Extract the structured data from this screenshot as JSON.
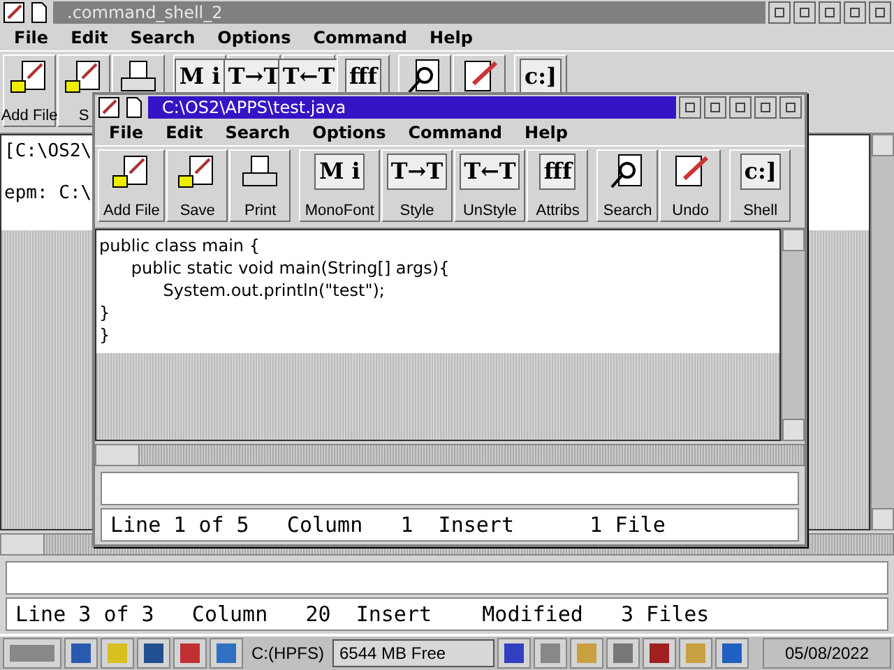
{
  "outer_window": {
    "title": ".command_shell_2",
    "active": false,
    "menu": [
      "File",
      "Edit",
      "Search",
      "Options",
      "Command",
      "Help"
    ],
    "toolbar": [
      [
        {
          "kind": "addfile",
          "label": "Add File"
        },
        {
          "kind": "save",
          "label": "S"
        },
        {
          "kind": "print"
        }
      ],
      [
        {
          "kind": "glyph",
          "glyph": "M i"
        },
        {
          "kind": "glyph",
          "glyph": "T→T"
        },
        {
          "kind": "glyph",
          "glyph": "T←T"
        },
        {
          "kind": "glyph",
          "glyph": "fff"
        }
      ],
      [
        {
          "kind": "search"
        },
        {
          "kind": "undo"
        }
      ],
      [
        {
          "kind": "glyph",
          "glyph": "c:]"
        }
      ]
    ],
    "lines": [
      "[C:\\OS2\\",
      "epm: C:\\"
    ],
    "status": "Line 3 of 3   Column   20  Insert    Modified   3 Files"
  },
  "inner_window": {
    "title": "C:\\OS2\\APPS\\test.java",
    "active": true,
    "menu": [
      "File",
      "Edit",
      "Search",
      "Options",
      "Command",
      "Help"
    ],
    "toolbar": [
      [
        {
          "kind": "addfile",
          "label": "Add File"
        },
        {
          "kind": "save",
          "label": "Save"
        },
        {
          "kind": "print",
          "label": "Print"
        }
      ],
      [
        {
          "kind": "glyph",
          "glyph": "M i",
          "label": "MonoFont"
        },
        {
          "kind": "glyph",
          "glyph": "T→T",
          "label": "Style"
        },
        {
          "kind": "glyph",
          "glyph": "T←T",
          "label": "UnStyle"
        },
        {
          "kind": "glyph",
          "glyph": "fff",
          "label": "Attribs"
        }
      ],
      [
        {
          "kind": "search",
          "label": "Search"
        },
        {
          "kind": "undo",
          "label": "Undo"
        }
      ],
      [
        {
          "kind": "glyph",
          "glyph": "c:]",
          "label": "Shell"
        }
      ]
    ],
    "lines": [
      "public class main {",
      "\tpublic static void main(String[] args){",
      "\t\tSystem.out.println(\"test\");",
      "}",
      "}"
    ],
    "status": "Line 1 of 5   Column   1  Insert      1 File"
  },
  "taskbar": {
    "drive": "C:(HPFS)",
    "free": "6544 MB Free",
    "date": "05/08/2022"
  }
}
